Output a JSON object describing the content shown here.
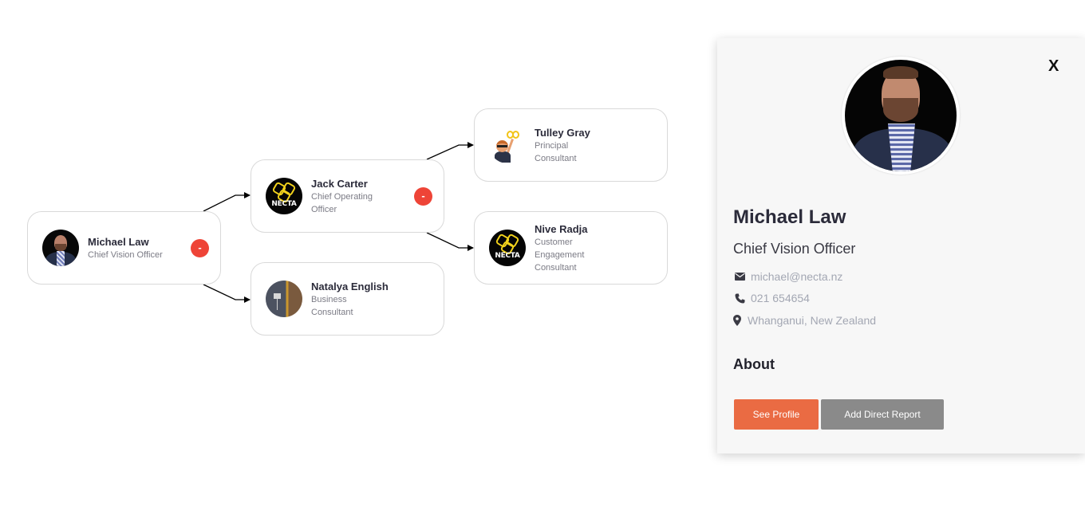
{
  "org_chart": {
    "nodes": [
      {
        "id": "michael",
        "name": "Michael Law",
        "role_lines": [
          "Chief Vision Officer"
        ],
        "avatar": "photo-portrait",
        "collapse_label": "-"
      },
      {
        "id": "jack",
        "name": "Jack Carter",
        "role_lines": [
          "Chief Operating",
          "Officer"
        ],
        "avatar": "necta-logo",
        "avatar_text": "NECTA",
        "collapse_label": "-"
      },
      {
        "id": "natalya",
        "name": "Natalya English",
        "role_lines": [
          "Business",
          "Consultant"
        ],
        "avatar": "photo-room"
      },
      {
        "id": "tulley",
        "name": "Tulley Gray",
        "role_lines": [
          "Principal",
          "Consultant"
        ],
        "avatar": "emoji-character"
      },
      {
        "id": "nive",
        "name": "Nive Radja",
        "role_lines": [
          "Customer",
          "Engagement",
          "Consultant"
        ],
        "avatar": "necta-logo",
        "avatar_text": "NECTA"
      }
    ],
    "edges": [
      {
        "from": "michael",
        "to": "jack"
      },
      {
        "from": "michael",
        "to": "natalya"
      },
      {
        "from": "jack",
        "to": "tulley"
      },
      {
        "from": "jack",
        "to": "nive"
      }
    ]
  },
  "detail_panel": {
    "close_label": "X",
    "name": "Michael Law",
    "title": "Chief Vision Officer",
    "email": "michael@necta.nz",
    "phone": "021 654654",
    "location": "Whanganui, New Zealand",
    "about_heading": "About",
    "buttons": {
      "see_profile": "See Profile",
      "add_direct_report": "Add Direct Report"
    },
    "icons": {
      "email": "envelope-icon",
      "phone": "phone-icon",
      "location": "map-pin-icon"
    }
  },
  "colors": {
    "collapse_button": "#ee4437",
    "primary_button": "#ea6b43",
    "secondary_button": "#8a8a8a",
    "panel_background": "#f7f7f7"
  }
}
